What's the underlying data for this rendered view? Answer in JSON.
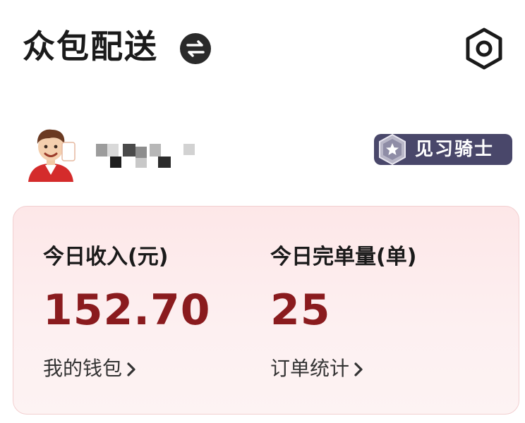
{
  "header": {
    "title": "众包配送",
    "switch_icon": "swap-arrows-icon",
    "settings_icon": "settings-hexagon-icon"
  },
  "profile": {
    "avatar_icon": "rider-avatar",
    "username": "",
    "rank_label": "见习骑士",
    "rank_emblem_icon": "rank-star-shield-icon"
  },
  "stats": {
    "income": {
      "label": "今日收入(元)",
      "value": "152.70",
      "link_label": "我的钱包"
    },
    "orders": {
      "label": "今日完单量(单)",
      "value": "25",
      "link_label": "订单统计"
    }
  },
  "colors": {
    "accent_red": "#8a1b1e",
    "badge_bg": "#49476a",
    "card_bg": "#fde7e8"
  }
}
